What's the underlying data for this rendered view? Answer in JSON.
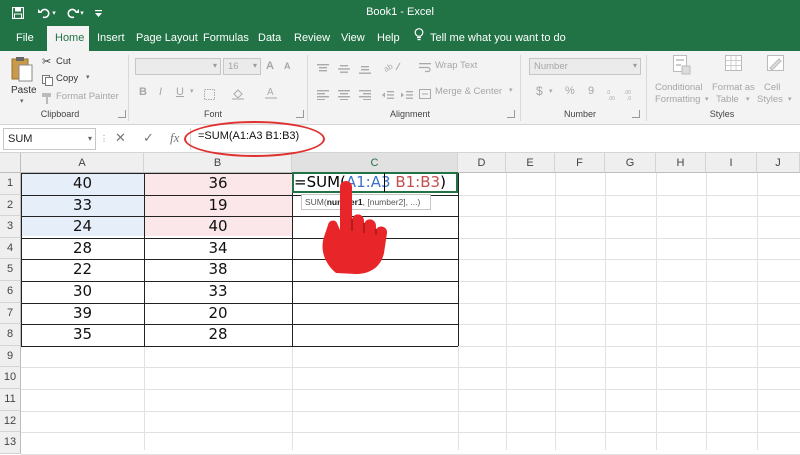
{
  "titlebar": {
    "document_title": "Book1  -  Excel",
    "icons": [
      "save-icon",
      "undo-icon",
      "undo-dropdown-icon",
      "redo-icon",
      "redo-dropdown-icon",
      "customize-quick-access-icon"
    ]
  },
  "tabs": [
    {
      "label": "File"
    },
    {
      "label": "Home"
    },
    {
      "label": "Insert"
    },
    {
      "label": "Page Layout"
    },
    {
      "label": "Formulas"
    },
    {
      "label": "Data"
    },
    {
      "label": "Review"
    },
    {
      "label": "View"
    },
    {
      "label": "Help"
    }
  ],
  "active_tab": "Home",
  "tell_me": "Tell me what you want to do",
  "ribbon": {
    "clipboard": {
      "paste": "Paste",
      "cut": "Cut",
      "copy": "Copy",
      "format_painter": "Format Painter",
      "group": "Clipboard"
    },
    "font": {
      "font_size": "16",
      "bold": "B",
      "italic": "I",
      "underline": "U",
      "group": "Font"
    },
    "alignment": {
      "wrap_text": "Wrap Text",
      "merge_center": "Merge & Center",
      "group": "Alignment"
    },
    "number": {
      "format": "Number",
      "currency": "$",
      "percent": "%",
      "comma": "9",
      "group": "Number"
    },
    "styles": {
      "conditional_1": "Conditional",
      "conditional_2": "Formatting",
      "format_table_1": "Format as",
      "format_table_2": "Table",
      "cell_styles_1": "Cell",
      "cell_styles_2": "Styles",
      "group": "Styles"
    }
  },
  "formula_bar": {
    "name_box": "SUM",
    "cancel": "✕",
    "enter": "✓",
    "fx": "fx",
    "formula": "=SUM(A1:A3 B1:B3)"
  },
  "columns": [
    "A",
    "B",
    "C",
    "D",
    "E",
    "F",
    "G",
    "H",
    "I",
    "J"
  ],
  "rows": [
    "1",
    "2",
    "3",
    "4",
    "5",
    "6",
    "7",
    "8",
    "9",
    "10",
    "11",
    "12",
    "13"
  ],
  "cells": {
    "A": [
      "40",
      "33",
      "24",
      "28",
      "22",
      "30",
      "39",
      "35"
    ],
    "B": [
      "36",
      "19",
      "40",
      "34",
      "38",
      "33",
      "20",
      "28"
    ]
  },
  "edit_cell": {
    "prefix": "=SUM(",
    "ref_a": "A1:A3",
    "space": " ",
    "ref_b": "B1:B3",
    "suffix": ")"
  },
  "tooltip": {
    "fn": "SUM(",
    "arg1": "number1",
    "rest": ", [number2], ...)"
  },
  "colors": {
    "excel_green": "#217346",
    "ref_a_fill": "#e6eef9",
    "ref_b_fill": "#fbe7e9",
    "ref_a_text": "#3c73c8",
    "ref_b_text": "#c0504d",
    "callout_red": "#e0312f"
  }
}
